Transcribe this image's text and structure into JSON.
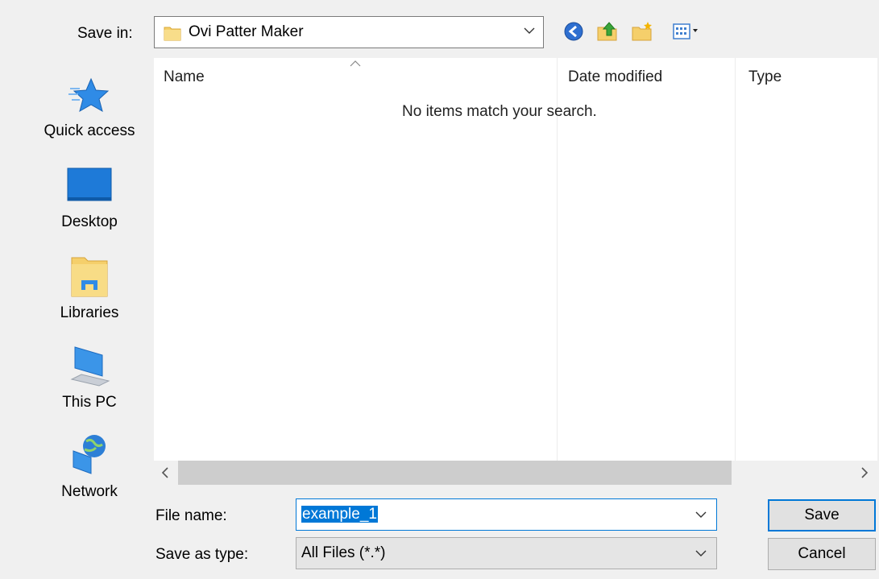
{
  "toolbar": {
    "save_in_label": "Save in:",
    "location": "Ovi Patter Maker"
  },
  "places": [
    {
      "label": "Quick access",
      "icon": "quick-access-icon"
    },
    {
      "label": "Desktop",
      "icon": "desktop-icon"
    },
    {
      "label": "Libraries",
      "icon": "libraries-icon"
    },
    {
      "label": "This PC",
      "icon": "this-pc-icon"
    },
    {
      "label": "Network",
      "icon": "network-icon"
    }
  ],
  "filelist": {
    "columns": [
      "Name",
      "Date modified",
      "Type"
    ],
    "empty_message": "No items match your search."
  },
  "form": {
    "file_name_label": "File name:",
    "file_name_value": "example_1",
    "save_as_type_label": "Save as type:",
    "save_as_type_value": "All Files (*.*)"
  },
  "buttons": {
    "save": "Save",
    "cancel": "Cancel"
  },
  "colors": {
    "accent": "#0078d7",
    "dialog_bg": "#f0f0f0",
    "folder": "#f2c94c"
  }
}
